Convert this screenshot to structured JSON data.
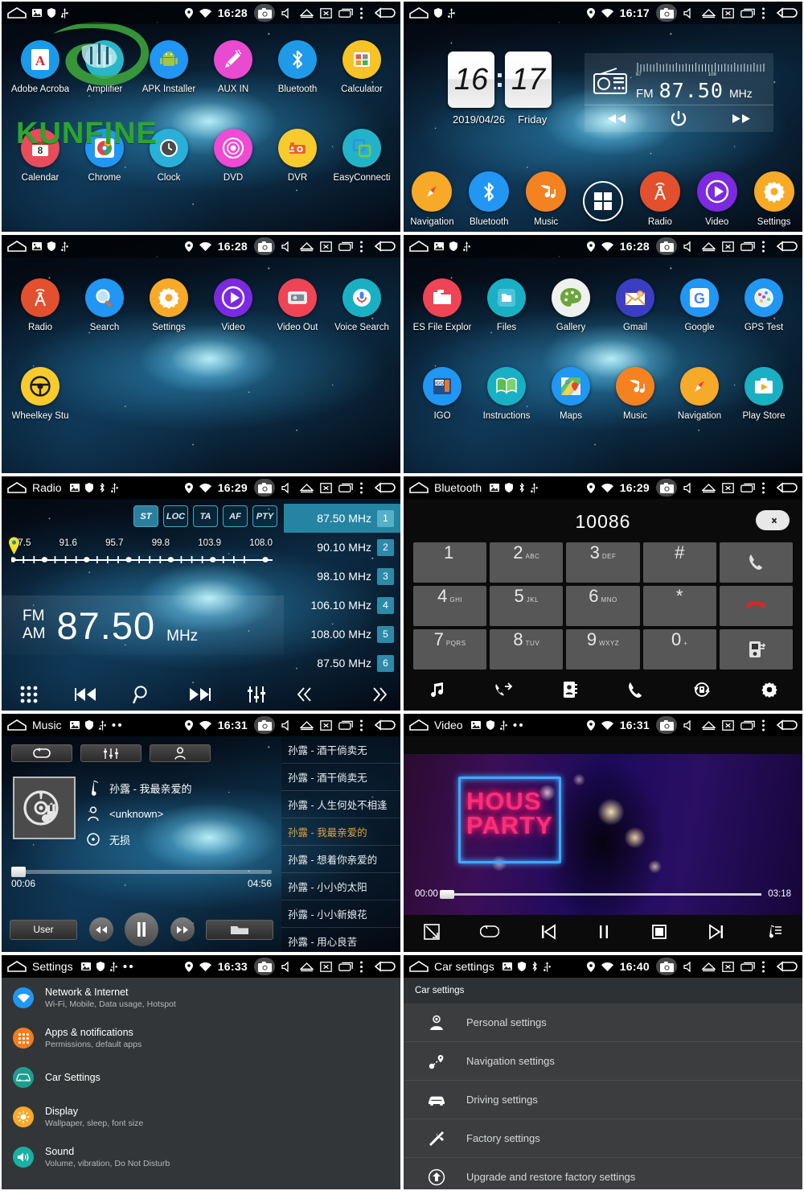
{
  "statusbar": {
    "icons": [
      "home-icon",
      "image-icon",
      "shield-icon",
      "usb-icon",
      "location-icon",
      "wifi-icon",
      "camera-icon",
      "mute-icon",
      "eject-icon",
      "close-window-icon",
      "recents-icon",
      "overflow-menu-icon",
      "back-icon"
    ],
    "clock_1628": "16:28",
    "clock_1617": "16:17",
    "clock_1629": "16:29",
    "clock_1631": "16:31",
    "clock_1633": "16:33",
    "clock_1640": "16:40"
  },
  "panel_apps1": {
    "watermark_text": "KUNFINE",
    "apps": [
      {
        "label": "Adobe Acroba",
        "icon": "adobe-acrobat-icon",
        "color": "#1a9ae8"
      },
      {
        "label": "Amplifier",
        "icon": "amplifier-icon",
        "color": "#29b6c8"
      },
      {
        "label": "APK Installer",
        "icon": "apk-installer-icon",
        "color": "#2196f3"
      },
      {
        "label": "AUX IN",
        "icon": "aux-in-icon",
        "color": "#e84ad0"
      },
      {
        "label": "Bluetooth",
        "icon": "bluetooth-icon",
        "color": "#1e9ae8"
      },
      {
        "label": "Calculator",
        "icon": "calculator-icon",
        "color": "#f7c325"
      },
      {
        "label": "Calendar",
        "icon": "calendar-icon",
        "color": "#e84b5a"
      },
      {
        "label": "Chrome",
        "icon": "chrome-icon",
        "color": "#2196f3"
      },
      {
        "label": "Clock",
        "icon": "clock-icon",
        "color": "#29b0d8"
      },
      {
        "label": "DVD",
        "icon": "dvd-icon",
        "color": "#ef4ad4"
      },
      {
        "label": "DVR",
        "icon": "dvr-icon",
        "color": "#f7cb2e"
      },
      {
        "label": "EasyConnecti",
        "icon": "easyconnection-icon",
        "color": "#23b3c9"
      }
    ]
  },
  "panel_home": {
    "clock": {
      "hours": "16",
      "minutes": "17",
      "date": "2019/04/26",
      "weekday": "Friday"
    },
    "radio_widget": {
      "icon": "radio-icon",
      "band": "FM",
      "frequency": "87.50",
      "unit": "MHz",
      "scale_min": "87",
      "scale_max": "108",
      "prev_icon": "prev-icon",
      "power_icon": "power-icon",
      "next_icon": "next-icon"
    },
    "dock": [
      {
        "label": "Navigation",
        "icon": "compass-icon",
        "color": "#f7a928"
      },
      {
        "label": "Bluetooth",
        "icon": "bluetooth-icon",
        "color": "#2196f3"
      },
      {
        "label": "Music",
        "icon": "music-note-icon",
        "color": "#f58220"
      },
      {
        "label": "",
        "icon": "all-apps-icon",
        "color": "transparent"
      },
      {
        "label": "Radio",
        "icon": "radio-tower-icon",
        "color": "#e2502e"
      },
      {
        "label": "Video",
        "icon": "play-circle-icon",
        "color": "#7b2ae0"
      },
      {
        "label": "Settings",
        "icon": "gear-icon",
        "color": "#f7a928"
      }
    ]
  },
  "panel_apps2": {
    "apps": [
      {
        "label": "Radio",
        "icon": "radio-tower-icon",
        "color": "#e2502e"
      },
      {
        "label": "Search",
        "icon": "magnifier-icon",
        "color": "#2196f3"
      },
      {
        "label": "Settings",
        "icon": "gear-icon",
        "color": "#f7a928"
      },
      {
        "label": "Video",
        "icon": "play-circle-icon",
        "color": "#7b2ae0"
      },
      {
        "label": "Video Out",
        "icon": "video-out-icon",
        "color": "#ef4455"
      },
      {
        "label": "Voice Search",
        "icon": "microphone-icon",
        "color": "#1ab0c4"
      },
      {
        "label": "Wheelkey Stu",
        "icon": "steering-wheel-icon",
        "color": "#f7cb2e"
      }
    ]
  },
  "panel_apps3": {
    "apps": [
      {
        "label": "ES File Explor",
        "icon": "folder-red-icon",
        "color": "#ef4455"
      },
      {
        "label": "Files",
        "icon": "files-icon",
        "color": "#1ab0c4"
      },
      {
        "label": "Gallery",
        "icon": "palette-icon",
        "color": "#eef1ee"
      },
      {
        "label": "Gmail",
        "icon": "envelope-icon",
        "color": "#3b3ec2"
      },
      {
        "label": "Google",
        "icon": "google-g-icon",
        "color": "#2196f3"
      },
      {
        "label": "GPS Test",
        "icon": "gps-test-icon",
        "color": "#2196f3"
      },
      {
        "label": "IGO",
        "icon": "igo-icon",
        "color": "#2196f3"
      },
      {
        "label": "Instructions",
        "icon": "book-icon",
        "color": "#1ab0c4"
      },
      {
        "label": "Maps",
        "icon": "maps-pin-icon",
        "color": "#2196f3"
      },
      {
        "label": "Music",
        "icon": "music-note-icon",
        "color": "#f58220"
      },
      {
        "label": "Navigation",
        "icon": "compass-icon",
        "color": "#f7a928"
      },
      {
        "label": "Play Store",
        "icon": "play-store-icon",
        "color": "#1ab0c4"
      }
    ]
  },
  "panel_radio": {
    "title": "Radio",
    "toggle_buttons": [
      {
        "label": "ST",
        "active": true
      },
      {
        "label": "LOC",
        "active": false
      },
      {
        "label": "TA",
        "active": false
      },
      {
        "label": "AF",
        "active": false
      },
      {
        "label": "PTY",
        "active": false
      }
    ],
    "scale_labels": [
      "87.5",
      "91.6",
      "95.7",
      "99.8",
      "103.9",
      "108.0"
    ],
    "band_fm": "FM",
    "band_am": "AM",
    "frequency": "87.50",
    "unit": "MHz",
    "control_icons": [
      "all-apps-icon",
      "prev-icon",
      "search-icon",
      "next-icon",
      "equalizer-icon"
    ],
    "presets": [
      {
        "freq": "87.50 MHz",
        "num": "1",
        "selected": true
      },
      {
        "freq": "90.10 MHz",
        "num": "2",
        "selected": false
      },
      {
        "freq": "98.10 MHz",
        "num": "3",
        "selected": false
      },
      {
        "freq": "106.10 MHz",
        "num": "4",
        "selected": false
      },
      {
        "freq": "108.00 MHz",
        "num": "5",
        "selected": false
      },
      {
        "freq": "87.50 MHz",
        "num": "6",
        "selected": false
      }
    ],
    "page_prev_icon": "double-chevron-left-icon",
    "page_next_icon": "double-chevron-right-icon"
  },
  "panel_bluetooth": {
    "title": "Bluetooth",
    "number": "10086",
    "delete_icon": "backspace-icon",
    "keys": [
      {
        "big": "1",
        "sub": ""
      },
      {
        "big": "2",
        "sub": "ABC"
      },
      {
        "big": "3",
        "sub": "DEF"
      },
      {
        "big": "#",
        "sub": ""
      },
      {
        "big": "",
        "sub": "",
        "icon": "call-icon"
      },
      {
        "big": "4",
        "sub": "GHI"
      },
      {
        "big": "5",
        "sub": "JKL"
      },
      {
        "big": "6",
        "sub": "MNO"
      },
      {
        "big": "*",
        "sub": ""
      },
      {
        "big": "",
        "sub": "",
        "icon": "hangup-icon"
      },
      {
        "big": "7",
        "sub": "PQRS"
      },
      {
        "big": "8",
        "sub": "TUV"
      },
      {
        "big": "9",
        "sub": "WXYZ"
      },
      {
        "big": "0",
        "sub": "+"
      },
      {
        "big": "",
        "sub": "",
        "icon": "transfer-call-icon"
      }
    ],
    "bottom_icons": [
      "bt-music-icon",
      "call-log-icon",
      "contacts-icon",
      "dialpad-call-icon",
      "sync-contacts-icon",
      "gear-icon"
    ]
  },
  "panel_music": {
    "title": "Music",
    "tabs": [
      {
        "icon": "repeat-icon"
      },
      {
        "icon": "equalizer-icon"
      },
      {
        "icon": "person-icon"
      }
    ],
    "album_art_icon": "cd-music-icon",
    "track_title": "孙露 - 我最亲爱的",
    "artist": "<unknown>",
    "quality": "无损",
    "time_current": "00:06",
    "time_total": "04:56",
    "user_button": "User",
    "prev_icon": "rewind-icon",
    "play_icon": "pause-icon",
    "next_icon": "forward-icon",
    "folder_icon": "folder-icon",
    "playlist": [
      {
        "name": "孙露 - 酒干倘卖无",
        "selected": false
      },
      {
        "name": "孙露 - 酒干倘卖无",
        "selected": false
      },
      {
        "name": "孙露 - 人生何处不相逢",
        "selected": false
      },
      {
        "name": "孙露 - 我最亲爱的",
        "selected": true
      },
      {
        "name": "孙露 - 想着你亲爱的",
        "selected": false
      },
      {
        "name": "孙露 - 小小的太阳",
        "selected": false
      },
      {
        "name": "孙露 - 小小新娘花",
        "selected": false
      },
      {
        "name": "孙露 - 用心良苦",
        "selected": false
      }
    ]
  },
  "panel_video": {
    "title": "Video",
    "neon_line1": "HOUS",
    "neon_line2": "PARTY",
    "time_current": "00:00",
    "time_total": "03:18",
    "control_icons": [
      "fullscreen-icon",
      "repeat-icon",
      "previous-icon",
      "pause-icon",
      "stop-icon",
      "next-icon",
      "playlist-icon"
    ]
  },
  "panel_settings": {
    "title": "Settings",
    "items": [
      {
        "title": "Network & Internet",
        "sub": "Wi-Fi, Mobile, Data usage, Hotspot",
        "icon": "wifi-icon",
        "color": "#2196f3"
      },
      {
        "title": "Apps & notifications",
        "sub": "Permissions, default apps",
        "icon": "apps-grid-icon",
        "color": "#f57c20"
      },
      {
        "title": "Car Settings",
        "sub": "",
        "icon": "car-icon",
        "color": "#1c9e8e"
      },
      {
        "title": "Display",
        "sub": "Wallpaper, sleep, font size",
        "icon": "brightness-icon",
        "color": "#f7a928"
      },
      {
        "title": "Sound",
        "sub": "Volume, vibration, Do Not Disturb",
        "icon": "speaker-icon",
        "color": "#1ab0a2"
      }
    ]
  },
  "panel_carsettings": {
    "title": "Car settings",
    "header": "Car settings",
    "items": [
      {
        "label": "Personal settings",
        "icon": "person-settings-icon"
      },
      {
        "label": "Navigation settings",
        "icon": "route-pin-icon"
      },
      {
        "label": "Driving settings",
        "icon": "car-icon"
      },
      {
        "label": "Factory settings",
        "icon": "tools-icon"
      },
      {
        "label": "Upgrade and restore factory settings",
        "icon": "upgrade-icon"
      }
    ]
  },
  "colors": {
    "accent_teal": "#2684a3",
    "accent_orange": "#e2a13a",
    "panel_dark": "#0b0b0b",
    "settings_gray": "#333638"
  }
}
